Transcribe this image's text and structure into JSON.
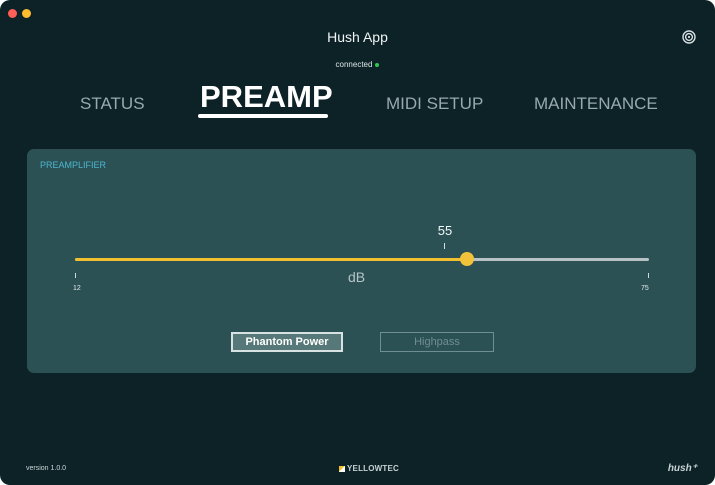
{
  "window": {
    "title": "Hush App",
    "connection_status": "connected",
    "connection_color": "#2ec84a",
    "traffic_lights": {
      "close_color": "#ff5f57",
      "minimize_color": "#febc2e"
    }
  },
  "settings_icon": "settings-icon",
  "tabs": [
    {
      "label": "STATUS",
      "active": false
    },
    {
      "label": "PREAMP",
      "active": true
    },
    {
      "label": "MIDI SETUP",
      "active": false
    },
    {
      "label": "MAINTENANCE",
      "active": false
    }
  ],
  "preamp": {
    "panel_label": "PREAMPLIFIER",
    "slider": {
      "value": 55,
      "value_label": "55",
      "min": 12,
      "max": 75,
      "min_label": "12",
      "max_label": "75",
      "unit": "dB"
    },
    "buttons": {
      "phantom_power": "Phantom Power",
      "highpass": "Highpass"
    }
  },
  "footer": {
    "version": "version 1.0.0",
    "brand": "YELLOWTEC",
    "logo": "hush⁺"
  },
  "colors": {
    "background": "#0d2226",
    "panel": "#2c5154",
    "accent": "#f0c030",
    "label_blue": "#4bb6d0"
  }
}
